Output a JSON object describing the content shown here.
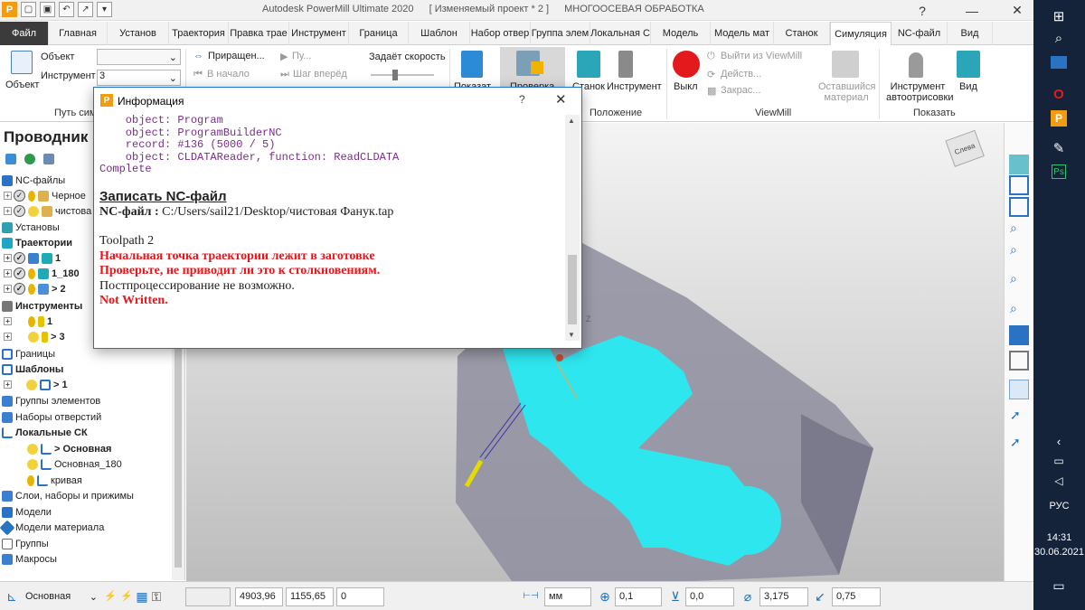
{
  "titlebar": {
    "app_title": "Autodesk PowerMill Ultimate 2020",
    "project": "[ Изменяемый проект * 2 ]",
    "mode": "МНОГООСЕВАЯ ОБРАБОТКА",
    "help_icon": "question-icon",
    "minimize": "—",
    "close": "✕"
  },
  "tabs": [
    {
      "label": "Файл"
    },
    {
      "label": "Главная"
    },
    {
      "label": "Установ"
    },
    {
      "label": "Траектория"
    },
    {
      "label": "Правка трае"
    },
    {
      "label": "Инструмент"
    },
    {
      "label": "Граница"
    },
    {
      "label": "Шаблон"
    },
    {
      "label": "Набор отвер"
    },
    {
      "label": "Группа элем"
    },
    {
      "label": "Локальная С"
    },
    {
      "label": "Модель"
    },
    {
      "label": "Модель мат"
    },
    {
      "label": "Станок"
    },
    {
      "label": "Симуляция"
    },
    {
      "label": "NC-файл"
    },
    {
      "label": "Вид"
    }
  ],
  "ribbon": {
    "object_label": "Объект",
    "object_field_label": "Объект",
    "object_value": "",
    "tool_label": "Инструмент",
    "tool_value": "3",
    "path_group": "Путь сим",
    "snap": "Приращен...",
    "start": "Пу...",
    "to_start": "В начало",
    "step_forward": "Шаг вперёд",
    "speed": "Задаёт скорость",
    "show": "Показат",
    "check": "Проверка",
    "machine": "Станок",
    "tool_btn": "Инструмент",
    "position_group": "Положение",
    "off": "Выкл",
    "exit_viewmill": "Выйти из ViewMill",
    "action": "Действ...",
    "paint": "Закрас...",
    "remaining": "Оставшийся материал",
    "viewmill_group": "ViewMill",
    "tool_autodraw": "Инструмент автоотрисовки",
    "view": "Вид",
    "show_group": "Показать",
    "speed_value": "..."
  },
  "explorer": {
    "title": "Проводник",
    "items": [
      {
        "label": "NC-файлы",
        "bold": false
      },
      {
        "label": "Черное",
        "bold": false
      },
      {
        "label": "чистова",
        "bold": false
      },
      {
        "label": "Установы",
        "bold": false
      },
      {
        "label": "Траектории",
        "bold": true
      },
      {
        "label": "1",
        "bold": true
      },
      {
        "label": "1_180",
        "bold": true
      },
      {
        "label": "> 2",
        "bold": true
      },
      {
        "label": "Инструменты",
        "bold": true
      },
      {
        "label": "1",
        "bold": true
      },
      {
        "label": "> 3",
        "bold": true
      },
      {
        "label": "Границы",
        "bold": false
      },
      {
        "label": "Шаблоны",
        "bold": true
      },
      {
        "label": "> 1",
        "bold": true
      },
      {
        "label": "Группы элементов",
        "bold": false
      },
      {
        "label": "Наборы отверстий",
        "bold": false
      },
      {
        "label": "Локальные СК",
        "bold": true
      },
      {
        "label": "> Основная",
        "bold": true
      },
      {
        "label": "Основная_180",
        "bold": false
      },
      {
        "label": "кривая",
        "bold": false
      },
      {
        "label": "Слои, наборы и прижимы",
        "bold": false
      },
      {
        "label": "Модели",
        "bold": false
      },
      {
        "label": "Модели материала",
        "bold": false
      },
      {
        "label": "Группы",
        "bold": false
      },
      {
        "label": "Макросы",
        "bold": false
      }
    ]
  },
  "viewport": {
    "viewcube_label": "Слева",
    "axis_label": "Z"
  },
  "dialog": {
    "title": "Информация",
    "help": "?",
    "close": "✕",
    "log_lines": [
      "    object: Program",
      "    object: ProgramBuilderNC",
      "    record: #136 (5000 / 5)",
      "    object: CLDATAReader, function: ReadCLDATA"
    ],
    "complete": "Complete",
    "write_heading": "Записать NC-файл",
    "nc_label": "NC-файл :",
    "nc_path": "C:/Users/sail21/Desktop/чистовая Фанук.tap",
    "toolpath": "Toolpath 2",
    "warning1": "Начальная точка траектории лежит в заготовке",
    "warning2": "Проверьте, не приводит ли это к столкновениям.",
    "no_post": "Постпроцессирование не возможно.",
    "not_written": "Not Written."
  },
  "statusbar": {
    "workplane": "Основная",
    "x": "4903,96",
    "y": "1155,65",
    "z": "0",
    "units": "мм",
    "tol": "0,1",
    "stock": "0,0",
    "diameter": "3,175",
    "stepover": "0,75"
  },
  "taskbar": {
    "lang": "РУС",
    "time": "14:31",
    "date": "30.06.2021"
  },
  "colors": {
    "accent": "#1a73c9",
    "part": "#2ee6ee",
    "stock": "#8e8e9f",
    "warning": "#e8161b",
    "taskbar": "#14233a"
  }
}
